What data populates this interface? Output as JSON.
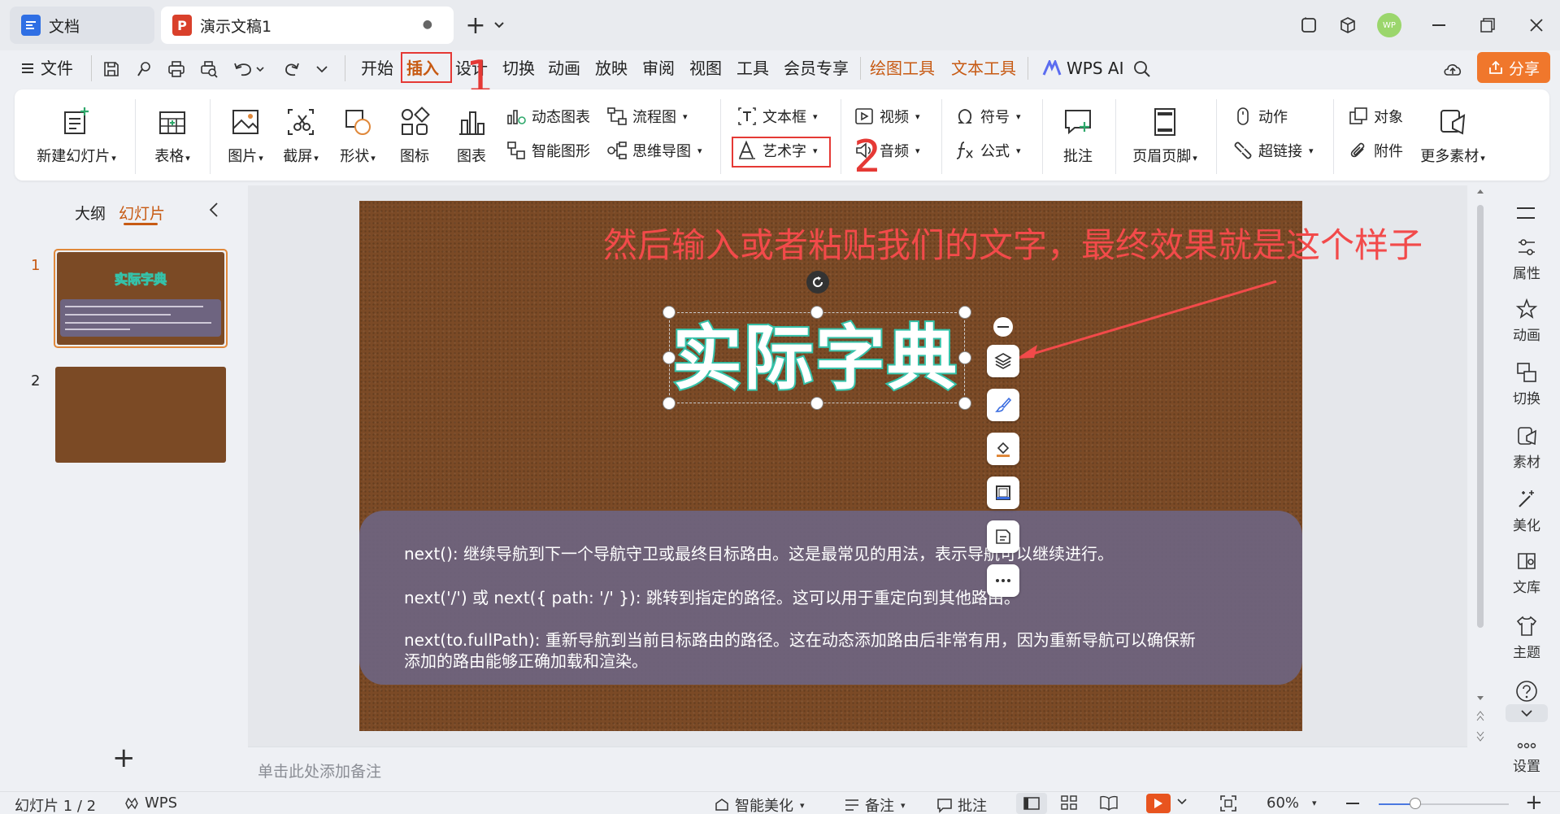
{
  "titlebar": {
    "tab_docs": "文档",
    "tab_pres": "演示文稿1",
    "tab_dot": "●",
    "new_tab": "+",
    "avatar": "WP"
  },
  "menu": {
    "file": "文件",
    "items": [
      "开始",
      "插入",
      "设计",
      "切换",
      "动画",
      "放映",
      "审阅",
      "视图",
      "工具",
      "会员专享"
    ],
    "contextual": [
      "绘图工具",
      "文本工具"
    ],
    "wps_ai": "WPS AI",
    "share": "分享"
  },
  "ribbon": {
    "new_slide": "新建幻灯片",
    "table": "表格",
    "picture": "图片",
    "screenshot": "截屏",
    "shape": "形状",
    "icon": "图标",
    "chart": "图表",
    "dynamic_chart": "动态图表",
    "smart_graphic": "智能图形",
    "flowchart": "流程图",
    "mindmap": "思维导图",
    "textbox": "文本框",
    "wordart": "艺术字",
    "video": "视频",
    "audio": "音频",
    "symbol": "符号",
    "formula": "公式",
    "comment": "批注",
    "header_footer": "页眉页脚",
    "action": "动作",
    "hyperlink": "超链接",
    "object": "对象",
    "attachment": "附件",
    "more_material": "更多素材"
  },
  "annotations": {
    "step1": "1",
    "step2": "2",
    "note": "然后输入或者粘贴我们的文字，最终效果就是这个样子"
  },
  "leftpanel": {
    "tab_outline": "大纲",
    "tab_slides": "幻灯片",
    "slide_numbers": [
      "1",
      "2"
    ],
    "add": "+",
    "thumb_title": "实际字典"
  },
  "slide": {
    "wordart_text": "实际字典",
    "paragraphs": [
      "next(): 继续导航到下一个导航守卫或最终目标路由。这是最常见的用法，表示导航可以继续进行。",
      "next('/') 或 next({ path: '/' }): 跳转到指定的路径。这可以用于重定向到其他路由。",
      "next(to.fullPath): 重新导航到当前目标路由的路径。这在动态添加路由后非常有用，因为重新导航可以确保新",
      "添加的路由能够正确加载和渲染。"
    ],
    "colors": {
      "background": "#7b4a26",
      "wordart_outline": "#35c2a9",
      "panel": "#6e6480",
      "annotation": "#f24a4a"
    }
  },
  "notes": {
    "placeholder": "单击此处添加备注"
  },
  "rightbar": [
    "属性",
    "动画",
    "切换",
    "素材",
    "美化",
    "文库",
    "主题",
    "设置"
  ],
  "status": {
    "slide_pos": "幻灯片 1 / 2",
    "wps": "WPS",
    "beautify": "智能美化",
    "notes": "备注",
    "comment": "批注",
    "zoom": "60%",
    "plus": "+"
  }
}
